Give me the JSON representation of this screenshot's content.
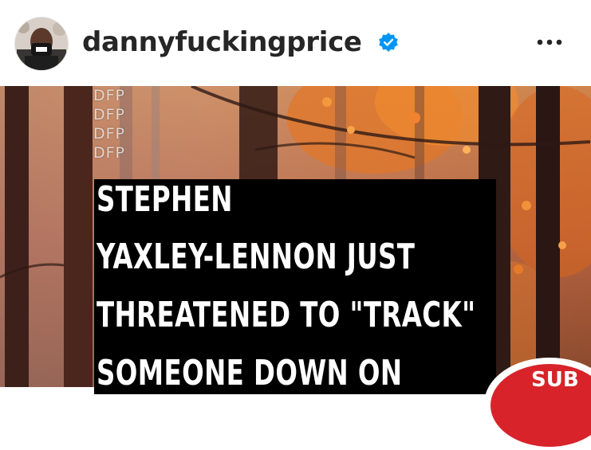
{
  "post": {
    "username": "dannyfuckingprice",
    "verified": true,
    "icons": {
      "avatar": "profile-avatar",
      "verified": "verified-badge-icon",
      "more": "more-options-icon"
    }
  },
  "media": {
    "watermark": [
      "DFP",
      "DFP",
      "DFP",
      "DFP"
    ],
    "headline_lines": [
      "STEPHEN",
      "YAXLEY-LENNON JUST",
      "THREATENED TO \"TRACK\"",
      "SOMEONE DOWN ON"
    ],
    "sticker_text": "SUB",
    "colors": {
      "text_box": "#000000",
      "headline_text": "#ffffff",
      "verified_blue": "#0095f6",
      "sticker_red": "#d8232a"
    }
  }
}
